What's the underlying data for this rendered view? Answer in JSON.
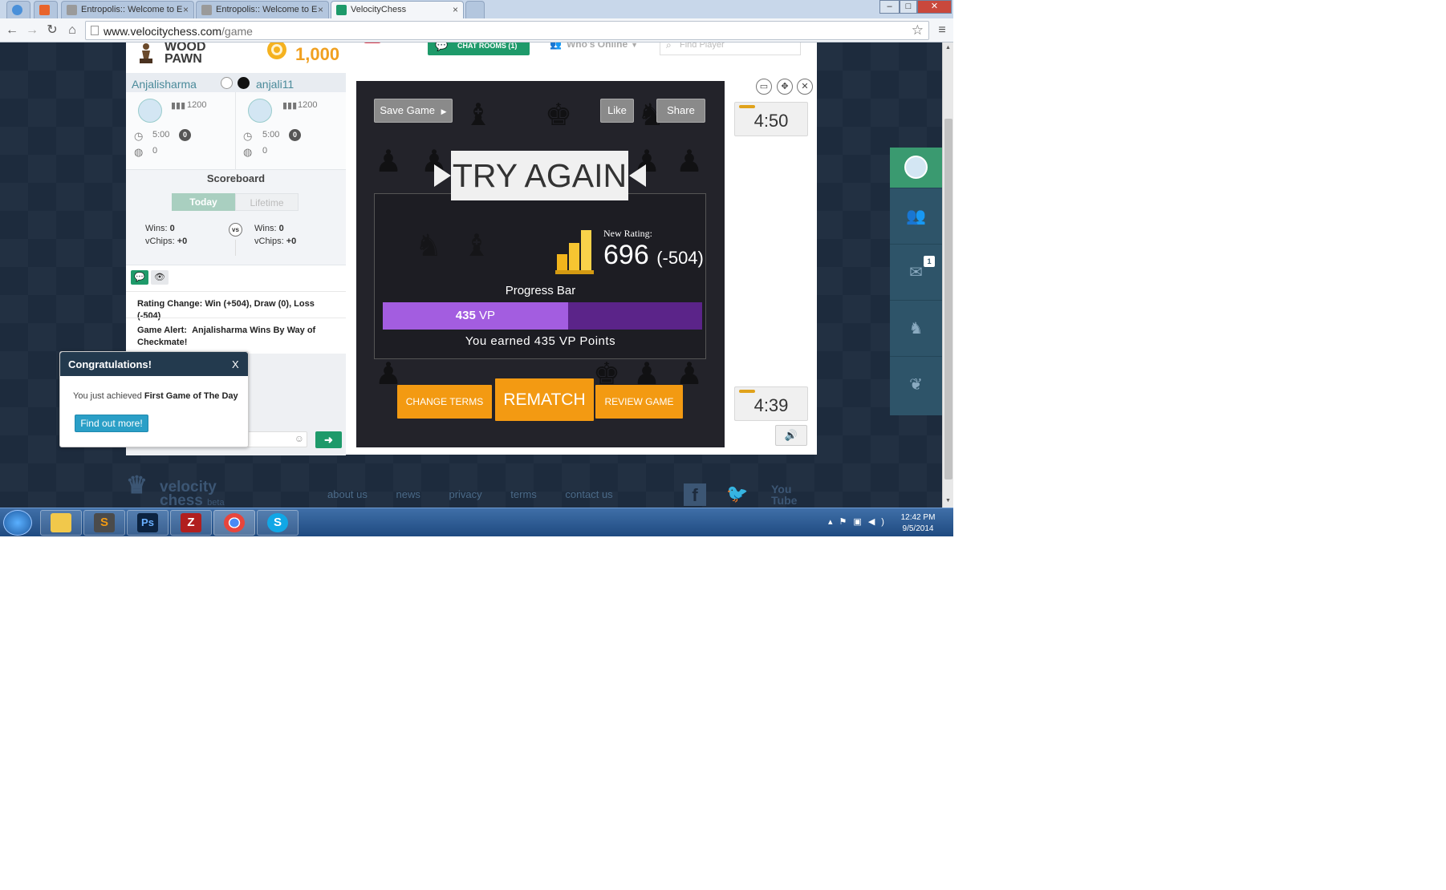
{
  "browser": {
    "tabs": [
      {
        "title": "Entropolis:: Welcome to E"
      },
      {
        "title": "Entropolis:: Welcome to E"
      },
      {
        "title": "VelocityChess"
      }
    ],
    "url_host": "www.velocitychess.com",
    "url_path": "/game"
  },
  "header": {
    "rank_line1": "WOOD",
    "rank_line2": "PAWN",
    "chips": "1,000",
    "chat_rooms": "CHAT ROOMS (1)",
    "whos_online": "Who's Online",
    "find_player_placeholder": "Find Player"
  },
  "players": {
    "white": {
      "name": "Anjalisharma",
      "rating": "1200",
      "time": "5:00",
      "badge": "0",
      "score": "0"
    },
    "black": {
      "name": "anjali11",
      "rating": "1200",
      "time": "5:00",
      "badge": "0",
      "score": "0"
    }
  },
  "scoreboard": {
    "title": "Scoreboard",
    "tab_today": "Today",
    "tab_lifetime": "Lifetime",
    "vs": "vs",
    "left": {
      "wins_label": "Wins:",
      "wins": "0",
      "vchips_label": "vChips:",
      "vchips": "+0"
    },
    "right": {
      "wins_label": "Wins:",
      "wins": "0",
      "vchips_label": "vChips:",
      "vchips": "+0"
    }
  },
  "chat": {
    "messages": [
      {
        "label": "Rating Change:",
        "text": "Win (+504), Draw (0), Loss (-504)"
      },
      {
        "label": "Game Alert:",
        "text": "Anjalisharma Wins By Way of",
        "text2": "Checkmate!"
      }
    ]
  },
  "result": {
    "save_game": "Save Game",
    "like": "Like",
    "share": "Share",
    "headline": "TRY AGAIN",
    "new_rating_label": "New Rating:",
    "new_rating": "696",
    "rating_delta": "(-504)",
    "progress_label": "Progress Bar",
    "progress_value": "435",
    "progress_unit": "VP",
    "progress_fraction": 0.58,
    "earned_text": "You earned 435 VP Points",
    "change_terms": "CHANGE TERMS",
    "rematch": "REMATCH",
    "review_game": "REVIEW GAME"
  },
  "timers": {
    "top": "4:50",
    "bottom": "4:39"
  },
  "dock": {
    "messages_count": "1"
  },
  "footer": {
    "logo_line1": "velocity",
    "logo_line2": "chess",
    "logo_suffix": "beta",
    "links": [
      "about us",
      "news",
      "privacy",
      "terms",
      "contact us"
    ]
  },
  "popup": {
    "title": "Congratulations!",
    "close": "X",
    "body_prefix": "You just achieved ",
    "achievement": "First Game of The Day",
    "button": "Find out more!"
  },
  "taskbar": {
    "time": "12:42 PM",
    "date": "9/5/2014"
  },
  "colors": {
    "brand_green": "#1e9a6a",
    "orange": "#f39a12",
    "progress_fill": "#a35de0",
    "progress_track": "#5b2489",
    "page_bg": "#1d2b3d"
  }
}
